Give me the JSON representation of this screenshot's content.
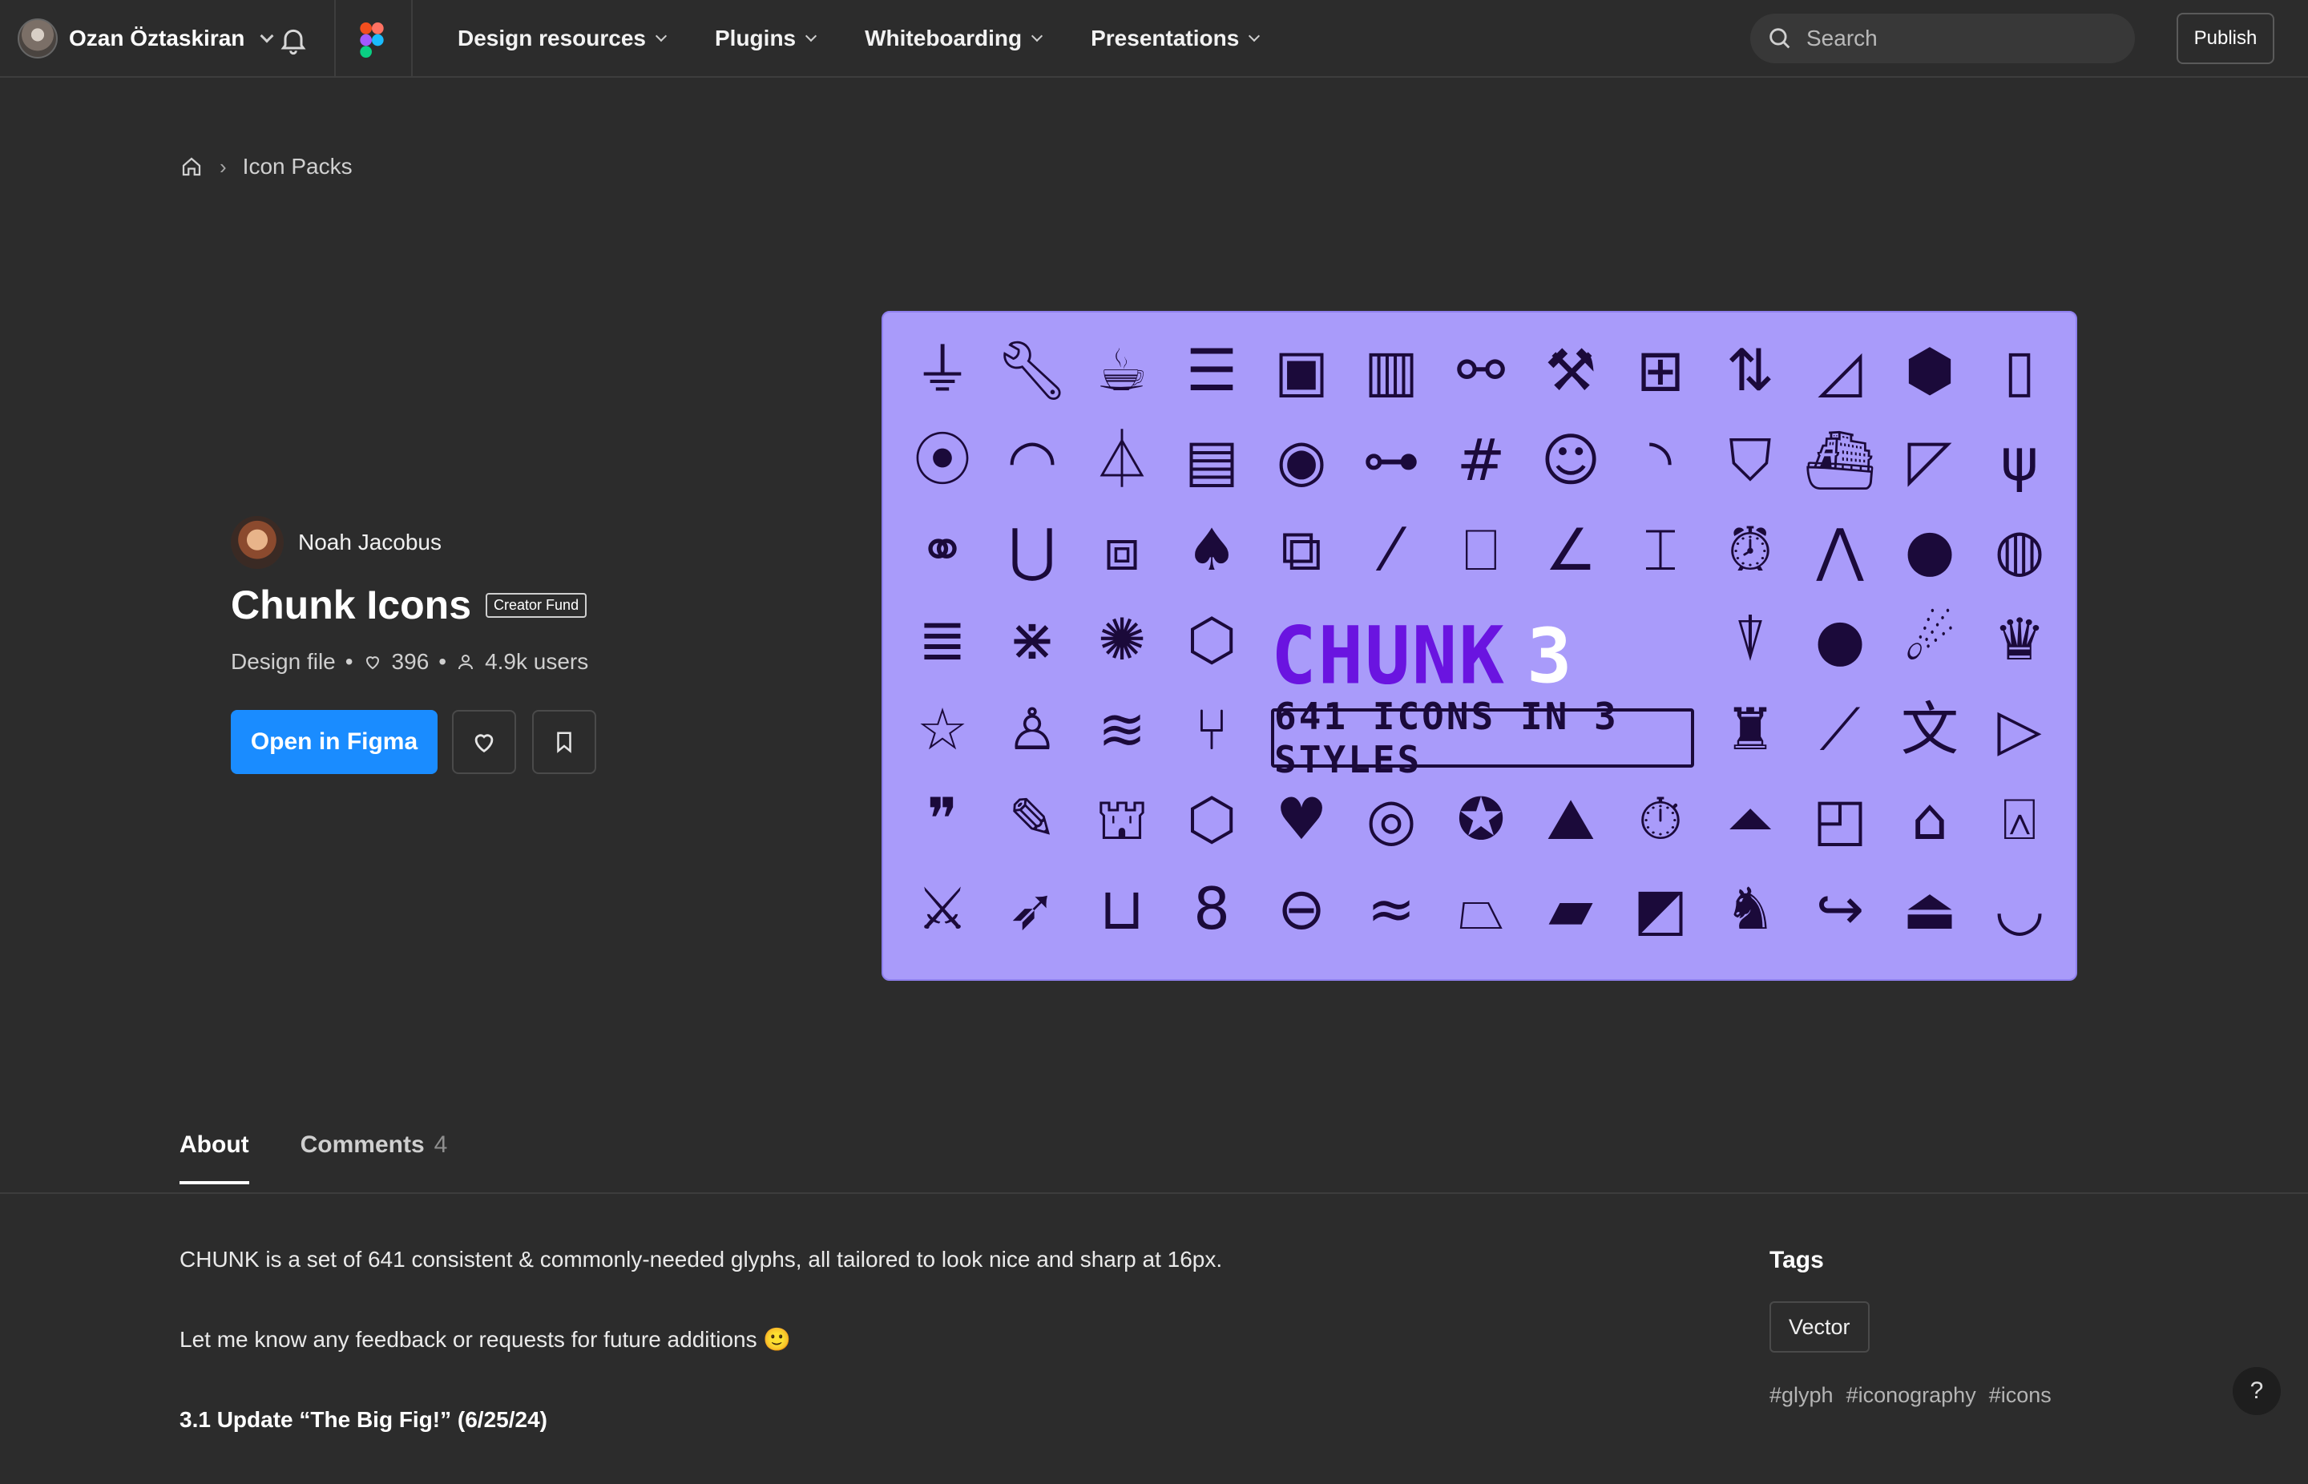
{
  "topbar": {
    "user_name": "Ozan Öztaskiran",
    "nav": [
      {
        "label": "Design resources"
      },
      {
        "label": "Plugins"
      },
      {
        "label": "Whiteboarding"
      },
      {
        "label": "Presentations"
      }
    ],
    "search_placeholder": "Search",
    "publish_label": "Publish"
  },
  "breadcrumb": {
    "current": "Icon Packs"
  },
  "file": {
    "author": "Noah Jacobus",
    "title": "Chunk Icons",
    "badge": "Creator Fund",
    "type": "Design file",
    "likes": "396",
    "users": "4.9k users",
    "open_label": "Open in Figma"
  },
  "hero": {
    "brand_word": "CHUNK",
    "brand_number": "3",
    "tagline": "641 ICONS IN 3 STYLES",
    "background": "#a99bfa",
    "accent": "#6a14e0"
  },
  "tabs": [
    {
      "label": "About",
      "count": ""
    },
    {
      "label": "Comments",
      "count": "4"
    }
  ],
  "about": {
    "p1": "CHUNK is a set of 641 consistent & commonly-needed glyphs, all tailored to look nice and sharp at 16px.",
    "p2": "Let me know any feedback or requests for future additions 🙂",
    "update_title": "3.1 Update “The Big Fig!” (6/25/24)"
  },
  "tags": {
    "title": "Tags",
    "chip": "Vector",
    "hashtags": [
      "#glyph",
      "#iconography",
      "#icons"
    ]
  },
  "help_label": "?"
}
